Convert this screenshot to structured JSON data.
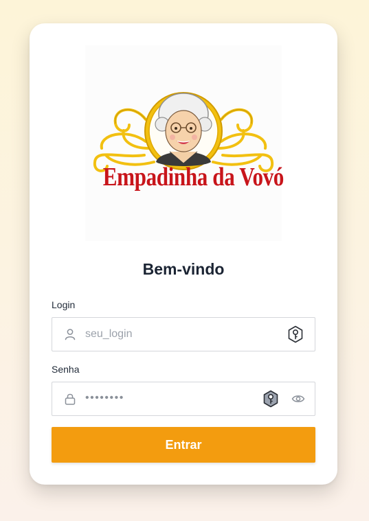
{
  "brand": {
    "logo_text": "Empadinha da Vovó",
    "primary_color": "#f39c0f",
    "logo_red": "#c8151b",
    "logo_gold": "#f2c011"
  },
  "login_card": {
    "title": "Bem-vindo",
    "login_field": {
      "label": "Login",
      "placeholder": "seu_login",
      "icon": "user-icon",
      "action_icon": "key-icon"
    },
    "password_field": {
      "label": "Senha",
      "value": "••••••••",
      "icon": "lock-icon",
      "action_icon": "key-icon",
      "toggle_icon": "eye-icon"
    },
    "submit_label": "Entrar"
  }
}
